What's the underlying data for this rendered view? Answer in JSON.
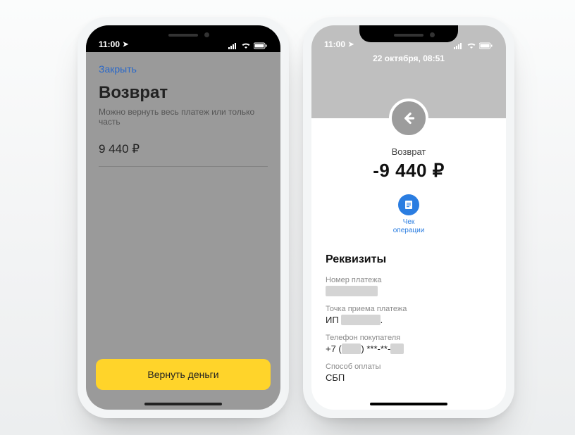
{
  "statusbar": {
    "time": "11:00"
  },
  "left": {
    "close": "Закрыть",
    "title": "Возврат",
    "subtitle": "Можно вернуть весь платеж или только часть",
    "amount": "9 440 ₽",
    "cta": "Вернуть деньги"
  },
  "right": {
    "date": "22 октября, 08:51",
    "label": "Возврат",
    "amount": "-9 440 ₽",
    "receipt_label": "Чек\nоперации",
    "section_title": "Реквизиты",
    "rows": {
      "payment_id_label": "Номер платежа",
      "payment_id_value": "████████",
      "merchant_label": "Точка приема платежа",
      "merchant_prefix": "ИП ",
      "merchant_masked": "██████",
      "merchant_suffix": ".",
      "phone_label": "Телефон покупателя",
      "phone_prefix": "+7 (",
      "phone_code_masked": "███",
      "phone_mid": ") ***-**-",
      "phone_tail_masked": "██",
      "method_label": "Способ оплаты",
      "method_value": "СБП"
    }
  }
}
